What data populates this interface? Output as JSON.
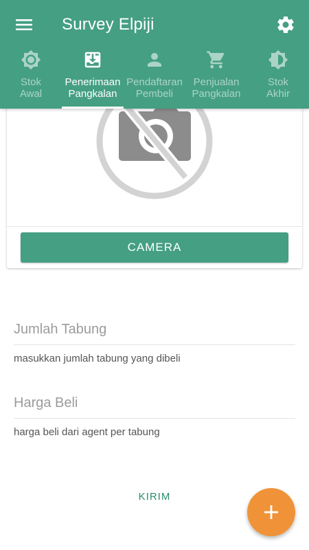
{
  "app": {
    "title": "Survey Elpiji",
    "colors": {
      "primary": "#459f82",
      "accent": "#f09338",
      "link": "#2e8a70"
    },
    "menu_icon": "menu-icon",
    "settings_icon": "gear-icon"
  },
  "tabs": [
    {
      "label": "Stok\nAwal",
      "icon": "brightness-icon",
      "active": false
    },
    {
      "label": "Penerimaan\nPangkalan",
      "icon": "download-box-icon",
      "active": true
    },
    {
      "label": "Pendaftaran\nPembeli",
      "icon": "person-icon",
      "active": false
    },
    {
      "label": "Penjualan\nPangkalan",
      "icon": "cart-icon",
      "active": false
    },
    {
      "label": "Stok\nAkhir",
      "icon": "contrast-icon",
      "active": false
    }
  ],
  "camera_card": {
    "placeholder_icon": "no-photo-icon",
    "button_label": "CAMERA"
  },
  "form": {
    "jumlah": {
      "placeholder": "Jumlah Tabung",
      "value": "",
      "hint": "masukkan jumlah tabung yang dibeli"
    },
    "harga": {
      "placeholder": "Harga Beli",
      "value": "",
      "hint": "harga beli dari agent per tabung"
    },
    "submit_label": "KIRIM"
  },
  "fab": {
    "icon": "plus-icon"
  }
}
